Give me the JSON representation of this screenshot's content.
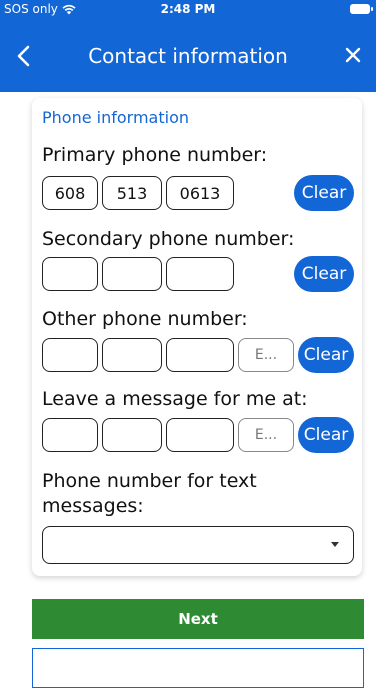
{
  "status_bar": {
    "carrier": "SOS only",
    "time": "2:48 PM"
  },
  "nav": {
    "title": "Contact information",
    "back_icon": "chevron-left-icon",
    "close_icon": "close-icon"
  },
  "section_title": "Phone information",
  "primary": {
    "label": "Primary phone number:",
    "area": "608",
    "prefix": "513",
    "line": "0613",
    "clear_label": "Clear"
  },
  "secondary": {
    "label": "Secondary phone number:",
    "area": "",
    "prefix": "",
    "line": "",
    "clear_label": "Clear"
  },
  "other": {
    "label": "Other phone number:",
    "area": "",
    "prefix": "",
    "line": "",
    "ext_placeholder": "E...",
    "clear_label": "Clear"
  },
  "message": {
    "label": "Leave a message for me at:",
    "area": "",
    "prefix": "",
    "line": "",
    "ext_placeholder": "E...",
    "clear_label": "Clear"
  },
  "text_messages": {
    "label_line1": "Phone number for text",
    "label_line2": "messages:",
    "selected_value": ""
  },
  "buttons": {
    "next_label": "Next"
  },
  "colors": {
    "brand_blue": "#1366d6",
    "next_green": "#2e8b34"
  }
}
